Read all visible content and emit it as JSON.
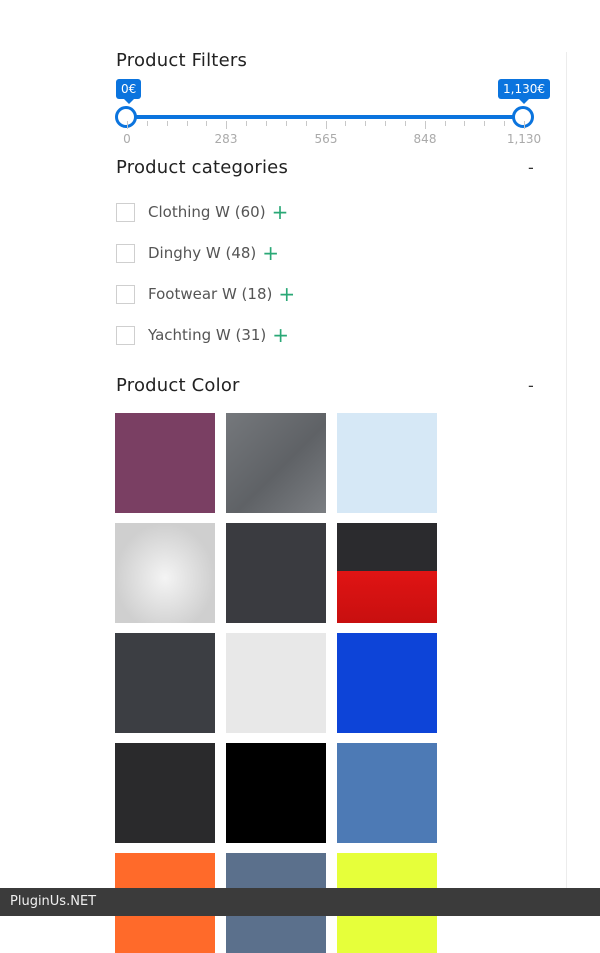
{
  "filters": {
    "title": "Product Filters",
    "price": {
      "min_label": "0€",
      "max_label": "1,130€",
      "ticks": [
        "0",
        "283",
        "565",
        "848",
        "1,130"
      ]
    }
  },
  "categories": {
    "title": "Product categories",
    "toggle": "-",
    "items": [
      {
        "label": "Clothing W (60)"
      },
      {
        "label": "Dinghy W (48)"
      },
      {
        "label": "Footwear W (18)"
      },
      {
        "label": "Yachting W (31)"
      }
    ]
  },
  "colors": {
    "title": "Product Color",
    "toggle": "-",
    "swatches": [
      {
        "color": "#7a3f63"
      },
      {
        "color": "#6b6e72"
      },
      {
        "color": "#d6e8f6"
      },
      {
        "color": "#cfcfcf"
      },
      {
        "color": "#3a3b40"
      },
      {
        "color": "#e01414"
      },
      {
        "color": "#3c3e43"
      },
      {
        "color": "#e8e8e8"
      },
      {
        "color": "#0d44d8"
      },
      {
        "color": "#2a2a2c"
      },
      {
        "color": "#000000"
      },
      {
        "color": "#4d7ab5"
      },
      {
        "color": "#ff6a2a"
      },
      {
        "color": "#5b708c"
      },
      {
        "color": "#e6ff3a"
      }
    ]
  },
  "footer": {
    "text": "PluginUs.NET"
  }
}
